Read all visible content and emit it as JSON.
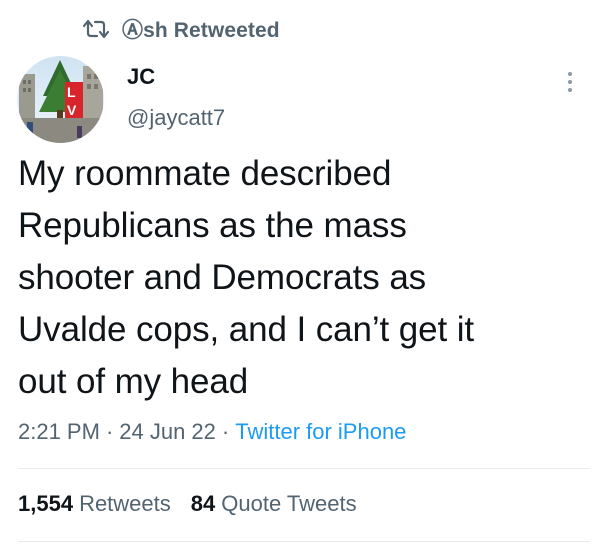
{
  "retweet": {
    "label": "Ⓐsh Retweeted",
    "icon": "retweet-icon"
  },
  "author": {
    "display_name": "JC",
    "handle": "@jaycatt7",
    "avatar_icon": "avatar-love-sculpture"
  },
  "tweet": {
    "text_lines": [
      "My roommate described",
      "Republicans as the mass",
      "shooter and Democrats as",
      "Uvalde cops, and I can’t get it",
      "out of my head"
    ]
  },
  "meta": {
    "time": "2:21 PM",
    "separator": "·",
    "date": "24 Jun 22",
    "source": "Twitter for iPhone"
  },
  "stats": {
    "retweets_count": "1,554",
    "retweets_label": "Retweets",
    "quotes_count": "84",
    "quotes_label": "Quote Tweets"
  },
  "colors": {
    "text": "#0f1419",
    "secondary": "#536471",
    "link": "#1d9bf0",
    "divider": "#e6ecf0"
  }
}
